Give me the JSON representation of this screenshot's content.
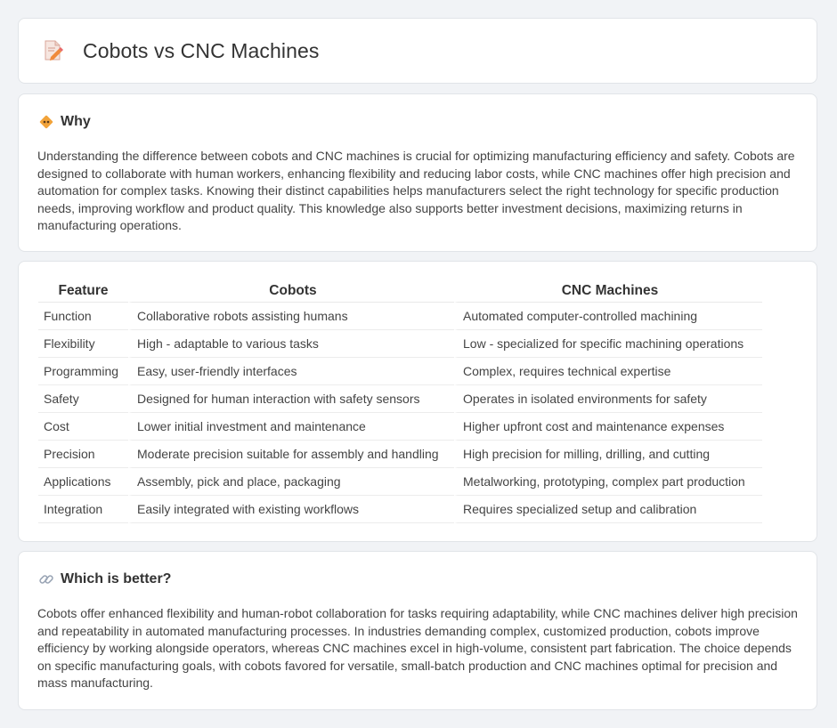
{
  "header": {
    "title": "Cobots vs CNC Machines",
    "icon": "document-edit-icon"
  },
  "why": {
    "title": "Why",
    "icon": "diamond-warning-icon",
    "text": "Understanding the difference between cobots and CNC machines is crucial for optimizing manufacturing efficiency and safety. Cobots are designed to collaborate with human workers, enhancing flexibility and reducing labor costs, while CNC machines offer high precision and automation for complex tasks. Knowing their distinct capabilities helps manufacturers select the right technology for specific production needs, improving workflow and product quality. This knowledge also supports better investment decisions, maximizing returns in manufacturing operations."
  },
  "comparison": {
    "headers": [
      "Feature",
      "Cobots",
      "CNC Machines"
    ],
    "rows": [
      [
        "Function",
        "Collaborative robots assisting humans",
        "Automated computer-controlled machining"
      ],
      [
        "Flexibility",
        "High - adaptable to various tasks",
        "Low - specialized for specific machining operations"
      ],
      [
        "Programming",
        "Easy, user-friendly interfaces",
        "Complex, requires technical expertise"
      ],
      [
        "Safety",
        "Designed for human interaction with safety sensors",
        "Operates in isolated environments for safety"
      ],
      [
        "Cost",
        "Lower initial investment and maintenance",
        "Higher upfront cost and maintenance expenses"
      ],
      [
        "Precision",
        "Moderate precision suitable for assembly and handling",
        "High precision for milling, drilling, and cutting"
      ],
      [
        "Applications",
        "Assembly, pick and place, packaging",
        "Metalworking, prototyping, complex part production"
      ],
      [
        "Integration",
        "Easily integrated with existing workflows",
        "Requires specialized setup and calibration"
      ]
    ]
  },
  "better": {
    "title": "Which is better?",
    "icon": "link-icon",
    "text": "Cobots offer enhanced flexibility and human-robot collaboration for tasks requiring adaptability, while CNC machines deliver high precision and repeatability in automated manufacturing processes. In industries demanding complex, customized production, cobots improve efficiency by working alongside operators, whereas CNC machines excel in high-volume, consistent part fabrication. The choice depends on specific manufacturing goals, with cobots favored for versatile, small-batch production and CNC machines optimal for precision and mass manufacturing."
  },
  "colors": {
    "background": "#f1f3f6",
    "card": "#ffffff",
    "icon_orange": "#f08a3c",
    "icon_pink": "#e86a6a"
  }
}
